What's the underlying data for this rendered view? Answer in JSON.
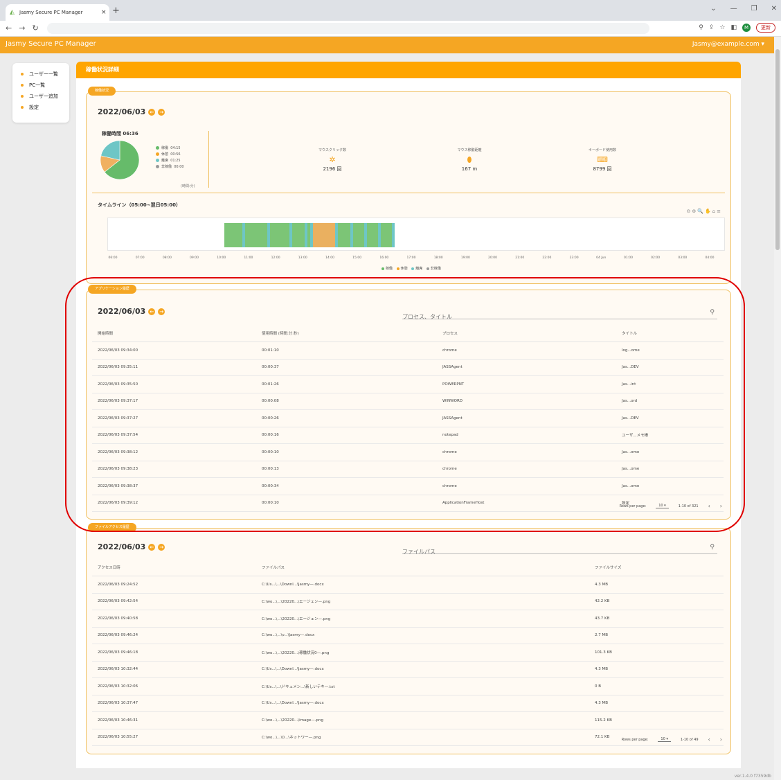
{
  "browser": {
    "tab_title": "Jasmy Secure PC Manager",
    "tab_close": "×",
    "new_tab": "+",
    "update_label": "更新"
  },
  "app": {
    "name": "Jasmy Secure PC Manager",
    "user_email": "Jasmy@example.com ▾",
    "version": "ver.1.4.0 f7359db"
  },
  "sidebar": {
    "items": [
      {
        "label": "ユーザー一覧"
      },
      {
        "label": "PC一覧"
      },
      {
        "label": "ユーザー追加"
      },
      {
        "label": "設定"
      }
    ]
  },
  "page_title": "稼働状況詳細",
  "operations": {
    "tag": "稼働状況",
    "date": "2022/06/03",
    "total_label": "稼働時間 06:36",
    "legend": [
      {
        "label": "稼働",
        "time": "04:15",
        "color": "#66bb6a"
      },
      {
        "label": "休憩",
        "time": "00:56",
        "color": "#f5a623"
      },
      {
        "label": "離席",
        "time": "01:25",
        "color": "#6ec6c6"
      },
      {
        "label": "非稼働",
        "time": "00:00",
        "color": "#999999"
      }
    ],
    "unit_note": "(時間:分)",
    "pie": [
      {
        "value": 255,
        "color": "#66bb6a"
      },
      {
        "value": 56,
        "color": "#f0b060"
      },
      {
        "value": 85,
        "color": "#6ec6c6"
      }
    ],
    "stats": [
      {
        "label": "マウスクリック数",
        "value": "2196 回",
        "icon": "mouse-click-icon"
      },
      {
        "label": "マウス移動距離",
        "value": "167 m",
        "icon": "mouse-icon"
      },
      {
        "label": "キーボード使用数",
        "value": "8799 回",
        "icon": "keyboard-icon"
      }
    ],
    "timeline_title": "タイムライン（05:00~翌日05:00）",
    "timeline_tools": "⊖⊕🔍✋⌂≡",
    "timeline_ticks": [
      "06:00",
      "07:00",
      "08:00",
      "09:00",
      "10:00",
      "11:00",
      "12:00",
      "13:00",
      "14:00",
      "15:00",
      "16:00",
      "17:00",
      "18:00",
      "19:00",
      "20:00",
      "21:00",
      "22:00",
      "23:00",
      "04 Jun",
      "01:00",
      "02:00",
      "03:00",
      "04:00"
    ],
    "timeline_legend": [
      "稼働",
      "休憩",
      "離席",
      "非稼働"
    ]
  },
  "applications": {
    "tag": "アプリケーション履歴",
    "date": "2022/06/03",
    "search_placeholder": "プロセス、タイトル",
    "columns": [
      "開始時間",
      "使用時間 (時間:分:秒)",
      "プロセス",
      "タイトル"
    ],
    "rows": [
      [
        "2022/06/03 09:34:00",
        "00:01:10",
        "chrome",
        "log...ome"
      ],
      [
        "2022/06/03 09:35:11",
        "00:00:37",
        "JASSAgent",
        "Jas...DEV"
      ],
      [
        "2022/06/03 09:35:50",
        "00:01:26",
        "POWERPNT",
        "Jas...int"
      ],
      [
        "2022/06/03 09:37:17",
        "00:00:08",
        "WINWORD",
        "Jas...ord"
      ],
      [
        "2022/06/03 09:37:27",
        "00:00:26",
        "JASSAgent",
        "Jas...DEV"
      ],
      [
        "2022/06/03 09:37:54",
        "00:00:16",
        "notepad",
        "ユーザ...メモ帳"
      ],
      [
        "2022/06/03 09:38:12",
        "00:00:10",
        "chrome",
        "Jas...ome"
      ],
      [
        "2022/06/03 09:38:23",
        "00:00:13",
        "chrome",
        "Jas...ome"
      ],
      [
        "2022/06/03 09:38:37",
        "00:00:34",
        "chrome",
        "Jas...ome"
      ],
      [
        "2022/06/03 09:39:12",
        "00:00:10",
        "ApplicationFrameHost",
        "設定"
      ]
    ],
    "rows_per_page_label": "Rows per page:",
    "rows_per_page": "10 ▾",
    "range": "1-10 of 321"
  },
  "files": {
    "tag": "ファイルアクセス履歴",
    "date": "2022/06/03",
    "search_placeholder": "ファイルパス",
    "columns": [
      "アクセス日時",
      "ファイルパス",
      "ファイルサイズ"
    ],
    "rows": [
      [
        "2022/06/03 09:24:52",
        "C:\\Us...\\...\\Downl...\\Jasmy—.docx",
        "4.3 MB"
      ],
      [
        "2022/06/03 09:42:54",
        "C:\\wo...\\...\\20220...\\エージェン—.png",
        "42.2 KB"
      ],
      [
        "2022/06/03 09:40:58",
        "C:\\wo...\\...\\20220...\\エージェン—.png",
        "43.7 KB"
      ],
      [
        "2022/06/03 09:46:24",
        "C:\\wo...\\...\\v...\\Jasmy—.docx",
        "2.7 MB"
      ],
      [
        "2022/06/03 09:46:18",
        "C:\\wo...\\...\\20220...\\稼働状況0—.png",
        "101.3 KB"
      ],
      [
        "2022/06/03 10:32:44",
        "C:\\Us...\\...\\Downl...\\Jasmy—.docx",
        "4.3 MB"
      ],
      [
        "2022/06/03 10:32:06",
        "C:\\Us...\\...\\ドキュメン...\\新しいテキ—.txt",
        "0 B"
      ],
      [
        "2022/06/03 10:37:47",
        "C:\\Us...\\...\\Downl...\\Jasmy—.docx",
        "4.3 MB"
      ],
      [
        "2022/06/03 10:46:31",
        "C:\\wo...\\...\\20220...\\image—.png",
        "115.2 KB"
      ],
      [
        "2022/06/03 10:55:27",
        "C:\\wo...\\...\\0...\\ネットワー—.png",
        "72.1 KB"
      ]
    ],
    "rows_per_page_label": "Rows per page:",
    "rows_per_page": "10 ▾",
    "range": "1-10 of 49"
  }
}
